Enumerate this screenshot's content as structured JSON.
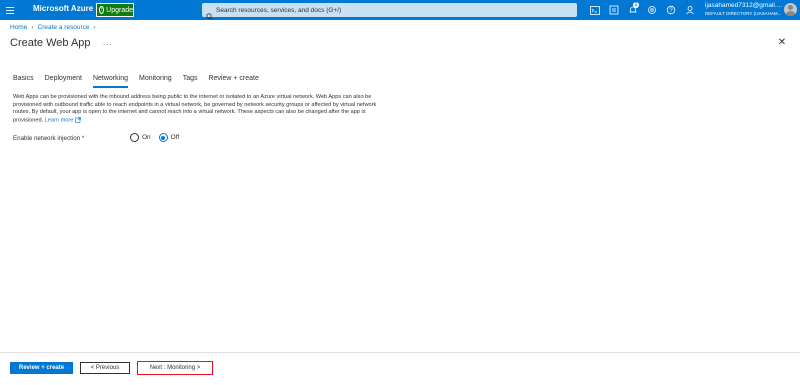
{
  "topbar": {
    "brand": "Microsoft Azure",
    "upgrade_label": "Upgrade",
    "search_placeholder": "Search resources, services, and docs (G+/)",
    "notification_count": "1",
    "user_name": "ijasahamed7312@gmail....",
    "user_directory": "DEFAULT DIRECTORY (IJASAHAM..."
  },
  "breadcrumb": {
    "items": [
      "Home",
      "Create a resource"
    ]
  },
  "page": {
    "title": "Create Web App",
    "more_label": "..."
  },
  "tabs": [
    {
      "label": "Basics"
    },
    {
      "label": "Deployment"
    },
    {
      "label": "Networking"
    },
    {
      "label": "Monitoring"
    },
    {
      "label": "Tags"
    },
    {
      "label": "Review + create"
    }
  ],
  "active_tab": "Networking",
  "networking": {
    "description": "Web Apps can be provisioned with the inbound address being public to the internet or isolated to an Azure virtual network. Web Apps can also be provisioned with outbound traffic able to reach endpoints in a virtual network, be governed by network security groups or affected by virtual network routes. By default, your app is open to the internet and cannot reach into a virtual network. These aspects can also be changed after the app is provisioned.",
    "learn_more": "Learn more",
    "field_label": "Enable network injection *",
    "options": [
      "On",
      "Off"
    ],
    "selected": "Off"
  },
  "footer": {
    "review_label": "Review + create",
    "previous_label": "< Previous",
    "next_label": "Next : Monitoring >"
  },
  "colors": {
    "brand": "#0078d4",
    "upgrade": "#107c10",
    "highlight": "#e81123"
  }
}
